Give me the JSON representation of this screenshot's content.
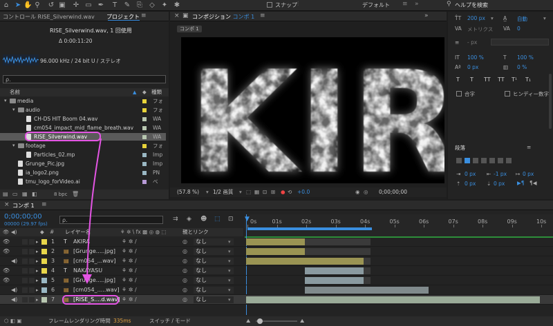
{
  "toolbar": {
    "snap_label": "スナップ",
    "workspace": "デフォルト",
    "search_placeholder": "ヘルプを検索"
  },
  "project_panel": {
    "tab_controls": "コントロール RISE_Silverwind.wav",
    "tab_project": "プロジェクト",
    "asset_name": "RISE_Silverwind.wav",
    "asset_usage": ", 1 回使用",
    "duration": "Δ 0:00:11:20",
    "audio_info": "96.000 kHz / 24 bit U / ステレオ",
    "search_placeholder": "ρ.",
    "col_name": "名前",
    "col_type": "種類",
    "bpc": "8 bpc",
    "items": [
      {
        "name": "media",
        "type": "フォ",
        "indent": 0,
        "kind": "folder",
        "color": "#e7d33a"
      },
      {
        "name": "audio",
        "type": "フォ",
        "indent": 1,
        "kind": "folder",
        "color": "#e7d33a"
      },
      {
        "name": "CH-DS HIT Boom 04.wav",
        "type": "WA",
        "indent": 2,
        "kind": "file",
        "color": "#b8c7b0"
      },
      {
        "name": "cm054_impact_mid_flame_breath.wav",
        "type": "WA",
        "indent": 2,
        "kind": "file",
        "color": "#b8c7b0"
      },
      {
        "name": "RISE_Silverwind.wav",
        "type": "WA",
        "indent": 2,
        "kind": "file",
        "color": "#b8c7b0",
        "selected": true
      },
      {
        "name": "footage",
        "type": "フォ",
        "indent": 1,
        "kind": "folder",
        "color": "#e7d33a"
      },
      {
        "name": "Particles_02.mp",
        "type": "Imp",
        "indent": 2,
        "kind": "file",
        "color": "#9ab8c4"
      },
      {
        "name": "Grunge_Pic.jpg",
        "type": "Imp",
        "indent": 1,
        "kind": "file",
        "color": "#9ab8c4"
      },
      {
        "name": "ia_logo2.png",
        "type": "PN",
        "indent": 1,
        "kind": "file",
        "color": "#9ab8c4"
      },
      {
        "name": "tmu_logo_forVideo.ai",
        "type": "べ",
        "indent": 1,
        "kind": "file",
        "color": "#b79ad6"
      }
    ]
  },
  "comp_panel": {
    "tab_label": "コンポジション",
    "comp_name": "コンポ 1",
    "breadcrumb": "コンポ 1",
    "zoom": "(57.8 %)",
    "resolution": "1/2 画質",
    "exposure": "+0.0",
    "timecode": "0;00;00;00",
    "preview_text": "KIR"
  },
  "char_panel": {
    "font_size": "200 px",
    "leading": "自動",
    "kerning_label": "メトリクス",
    "tracking": "0",
    "stroke": "- px",
    "vscale": "100 %",
    "hscale": "100 %",
    "baseline": "0 px",
    "tsume": "0 %",
    "ligatures": "合字",
    "hindi": "ヒンディー数字",
    "paragraph_title": "段落",
    "indent_values": [
      "0 px",
      "-1 px",
      "0 px",
      "0 px",
      "0 px"
    ],
    "style_buttons": [
      "T",
      "T",
      "TT",
      "TT",
      "T¹",
      "T₁"
    ]
  },
  "timeline": {
    "tab": "コンポ 1",
    "timecode": "0;00;00;00",
    "frame_info": "00000 (29.97 fps)",
    "search_placeholder": "ρ.",
    "col_layer": "レイヤー名",
    "col_parent": "親とリンク",
    "ruler": [
      "0s",
      "01s",
      "02s",
      "03s",
      "04s",
      "05s",
      "06s",
      "07s",
      "08s",
      "09s",
      "10s"
    ],
    "footer_render_label": "フレームレンダリング時間",
    "footer_render_value": "335ms",
    "footer_switch_label": "スイッチ / モード",
    "layers": [
      {
        "num": "1",
        "kind": "T",
        "name": "AKIRA",
        "parent": "なし",
        "color": "#e8d64a",
        "bar_start": 0.0,
        "bar_end": 2.0,
        "bar_color": "#9a9453",
        "video": true,
        "audio": false
      },
      {
        "num": "2",
        "kind": "img",
        "name": "[Grunge.....jpg]",
        "parent": "なし",
        "color": "#e8d64a",
        "bar_start": 0.0,
        "bar_end": 2.0,
        "bar_color": "#9a9453",
        "video": true,
        "audio": false
      },
      {
        "num": "3",
        "kind": "aud",
        "name": "[cm054_...wav]",
        "parent": "なし",
        "color": "#e8d64a",
        "bar_start": 0.0,
        "bar_end": 4.0,
        "bar_color": "#9a9453",
        "video": false,
        "audio": true
      },
      {
        "num": "4",
        "kind": "T",
        "name": "NAKAYASU",
        "parent": "なし",
        "color": "#e8d64a",
        "bar_start": 2.0,
        "bar_end": 4.0,
        "bar_color": "#8a9aa0",
        "video": true,
        "audio": false
      },
      {
        "num": "5",
        "kind": "img",
        "name": "[Grunge.....jpg]",
        "parent": "なし",
        "color": "#9ab8c4",
        "bar_start": 2.0,
        "bar_end": 4.0,
        "bar_color": "#8a9aa0",
        "video": true,
        "audio": false
      },
      {
        "num": "6",
        "kind": "aud",
        "name": "[cm054_.....wav]",
        "parent": "なし",
        "color": "#9ab8c4",
        "bar_start": 2.0,
        "bar_end": 6.2,
        "bar_color": "#808a8c",
        "video": false,
        "audio": true
      },
      {
        "num": "7",
        "kind": "aud",
        "name": "[RISE_S....d.wav]",
        "parent": "なし",
        "color": "#b8c7b0",
        "bar_start": 0.0,
        "bar_end": 10.0,
        "bar_color": "#9aab98",
        "video": false,
        "audio": true,
        "selected": true
      }
    ]
  },
  "colors": {
    "accent": "#3a8fe0",
    "highlight": "#e455e4",
    "selected_row": "#5a5a5a"
  }
}
